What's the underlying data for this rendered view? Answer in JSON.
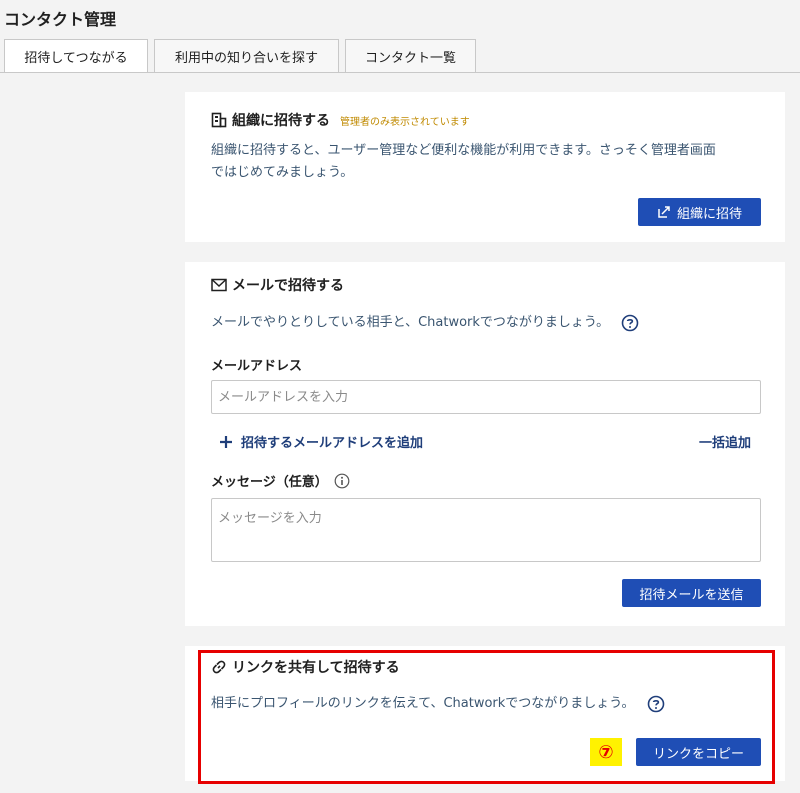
{
  "header": {
    "title": "コンタクト管理"
  },
  "tabs": [
    {
      "label": "招待してつながる",
      "active": true
    },
    {
      "label": "利用中の知り合いを探す",
      "active": false
    },
    {
      "label": "コンタクト一覧",
      "active": false
    }
  ],
  "org_invite": {
    "title": "組織に招待する",
    "admin_note": "管理者のみ表示されています",
    "description_line1": "組織に招待すると、ユーザー管理など便利な機能が利用できます。さっそく管理者画面",
    "description_line2": "ではじめてみましょう。",
    "button_label": "組織に招待"
  },
  "mail_invite": {
    "title": "メールで招待する",
    "description": "メールでやりとりしている相手と、Chatworkでつながりましょう。",
    "email_label": "メールアドレス",
    "email_placeholder": "メールアドレスを入力",
    "add_email_label": "招待するメールアドレスを追加",
    "bulk_add_label": "一括追加",
    "message_label": "メッセージ（任意）",
    "message_placeholder": "メッセージを入力",
    "send_button_label": "招待メールを送信"
  },
  "link_invite": {
    "title": "リンクを共有して招待する",
    "description": "相手にプロフィールのリンクを伝えて、Chatworkでつながりましょう。",
    "copy_button_label": "リンクをコピー"
  },
  "annotation": {
    "step_label": "⑦"
  },
  "colors": {
    "accent": "#1f4eb5",
    "highlight_border": "#e60000",
    "badge_background": "#fff200",
    "admin_note": "#c08a00"
  },
  "icons": {
    "org": "building-icon",
    "mail": "envelope-icon",
    "link": "link-icon",
    "help": "question-circle-icon",
    "info": "info-circle-icon",
    "plus": "plus-icon",
    "external": "external-link-icon"
  }
}
